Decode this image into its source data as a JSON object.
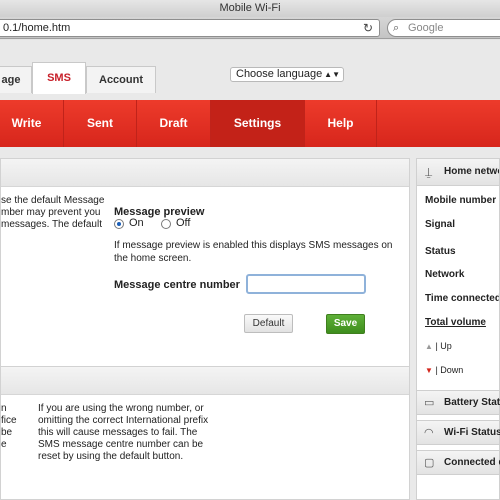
{
  "browser": {
    "window_title": "Mobile Wi-Fi",
    "url": "0.1/home.htm",
    "search_placeholder": "Google"
  },
  "top_tabs": [
    {
      "label": "age"
    },
    {
      "label": "SMS"
    },
    {
      "label": "Account"
    }
  ],
  "language_select": {
    "value": "Choose language"
  },
  "nav": [
    {
      "label": "Write"
    },
    {
      "label": "Sent"
    },
    {
      "label": "Draft"
    },
    {
      "label": "Settings"
    },
    {
      "label": "Help"
    }
  ],
  "settings": {
    "left_text": [
      "se the default Message",
      "mber may prevent you",
      "messages. The default"
    ],
    "preview_label": "Message preview",
    "radio_on": "On",
    "radio_off": "Off",
    "hint": "If message preview is enabled this displays SMS messages on the home screen.",
    "centre_label": "Message centre number",
    "centre_value": "",
    "default_button": "Default",
    "save_button": "Save"
  },
  "help": {
    "left_text": [
      "n",
      "fice",
      "be",
      "e"
    ],
    "right_text": "If you are using the wrong number, or omitting the correct International prefix this will cause messages to fail. The SMS message centre number can be reset by using the default button."
  },
  "sidebar": {
    "title": "Home netwo",
    "rows": [
      "Mobile number",
      "Signal",
      "Status",
      "Network",
      "Time connected",
      "Total volume"
    ],
    "up": "| Up",
    "down": "| Down",
    "battery": "Battery Statu",
    "wifi": "Wi-Fi Status",
    "connected": "Connected d"
  }
}
